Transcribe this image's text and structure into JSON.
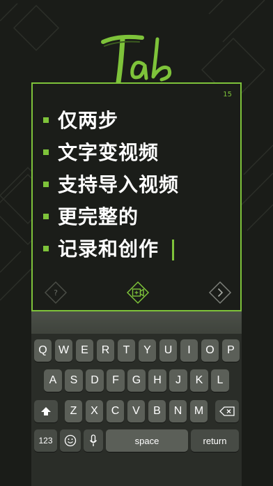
{
  "logo": {
    "text": "Tab"
  },
  "card": {
    "counter": "15",
    "lines": [
      "仅两步",
      "文字变视频",
      "支持导入视频",
      "更完整的",
      "记录和创作"
    ]
  },
  "icons": {
    "help": "help-icon",
    "video": "video-add-icon",
    "next": "next-icon"
  },
  "keyboard": {
    "row1": [
      "Q",
      "W",
      "E",
      "R",
      "T",
      "Y",
      "U",
      "I",
      "O",
      "P"
    ],
    "row2": [
      "A",
      "S",
      "D",
      "F",
      "G",
      "H",
      "J",
      "K",
      "L"
    ],
    "row3": [
      "Z",
      "X",
      "C",
      "V",
      "B",
      "N",
      "M"
    ],
    "numbers_label": "123",
    "space_label": "space",
    "return_label": "return"
  },
  "colors": {
    "accent": "#7ec33a",
    "background": "#1a1c18",
    "key": "#5b5f58"
  }
}
